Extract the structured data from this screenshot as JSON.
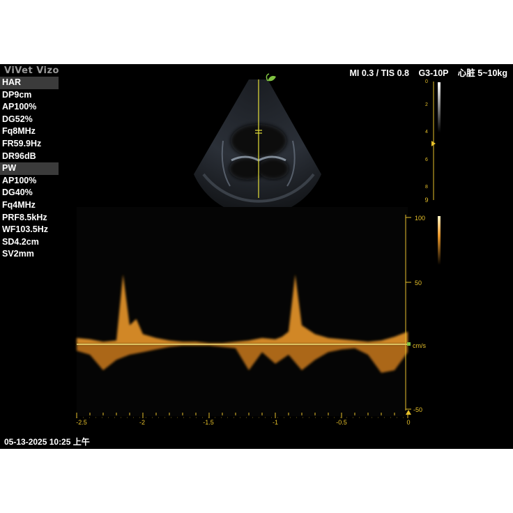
{
  "brand": "ViVet Vizo",
  "header": {
    "mi_tis": "MI 0.3 / TIS 0.8",
    "probe": "G3-10P",
    "preset": "心脏 5~10kg"
  },
  "params_2d": [
    "HAR",
    "DP9cm",
    "AP100%",
    "DG52%",
    "Fq8MHz",
    "FR59.9Hz",
    "DR96dB"
  ],
  "params_pw": [
    "PW",
    "AP100%",
    "DG40%",
    "Fq4MHz",
    "PRF8.5kHz",
    "WF103.5Hz",
    "SD4.2cm",
    "SV2mm"
  ],
  "depth_scale": {
    "ticks": [
      "0",
      "2",
      "4",
      "6",
      "8"
    ],
    "end_label": "9"
  },
  "velocity_scale": {
    "unit": "cm/s",
    "ticks": [
      "100",
      "50",
      "-50"
    ]
  },
  "time_axis": {
    "ticks": [
      "-2.5",
      "-2",
      "-1.5",
      "-1",
      "-0.5",
      "0"
    ]
  },
  "timestamp": "05-13-2025 10:25 上午",
  "colors": {
    "background": "#000000",
    "doppler": "#e89a2c",
    "baseline": "#f4e27a",
    "scale": "#e6c02a",
    "logo_leaf": "#7fc241"
  },
  "chart_data": {
    "type": "line",
    "title": "",
    "xlabel": "",
    "ylabel": "cm/s",
    "xlim": [
      -2.5,
      0
    ],
    "ylim": [
      -50,
      100
    ],
    "series": [
      {
        "x": [
          -2.5,
          -2.4,
          -2.3,
          -2.2,
          -2.15,
          -2.1,
          -2.05,
          -2.0,
          -1.9,
          -1.8,
          -1.7,
          -1.6,
          -1.5,
          -1.4,
          -1.3,
          -1.2,
          -1.1,
          -1.0,
          -0.95,
          -0.9,
          -0.85,
          -0.8,
          -0.7,
          -0.6,
          -0.5,
          -0.4,
          -0.3,
          -0.2,
          -0.1,
          0.0
        ],
        "y": [
          5,
          4,
          2,
          3,
          55,
          15,
          20,
          8,
          5,
          3,
          2,
          2,
          1,
          1,
          2,
          3,
          5,
          4,
          6,
          10,
          55,
          15,
          8,
          5,
          4,
          3,
          2,
          3,
          6,
          10
        ]
      },
      {
        "x": [
          -2.5,
          -2.4,
          -2.3,
          -2.2,
          -2.1,
          -2.0,
          -1.9,
          -1.8,
          -1.7,
          -1.6,
          -1.5,
          -1.4,
          -1.3,
          -1.2,
          -1.1,
          -1.0,
          -0.9,
          -0.8,
          -0.7,
          -0.6,
          -0.5,
          -0.4,
          -0.3,
          -0.2,
          -0.1,
          0.0
        ],
        "y": [
          -5,
          -8,
          -20,
          -12,
          -8,
          -6,
          -4,
          -2,
          -1,
          -1,
          -1,
          -2,
          -3,
          -20,
          -6,
          -15,
          -8,
          -20,
          -12,
          -6,
          -4,
          -3,
          -8,
          -22,
          -20,
          -6
        ]
      }
    ]
  }
}
